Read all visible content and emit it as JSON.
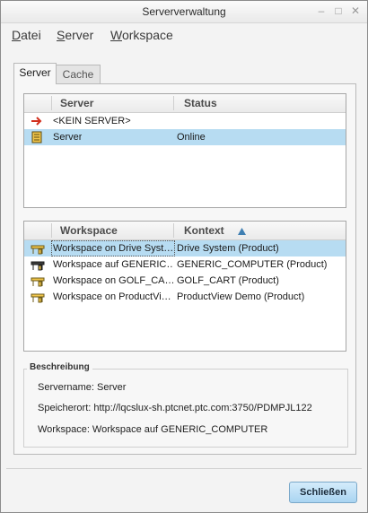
{
  "window": {
    "title": "Serververwaltung",
    "controls": [
      "minimize-icon",
      "maximize-icon",
      "close-icon"
    ]
  },
  "menu": [
    {
      "mnemonic": "D",
      "rest": "atei"
    },
    {
      "mnemonic": "S",
      "rest": "erver"
    },
    {
      "mnemonic": "W",
      "rest": "orkspace"
    }
  ],
  "tabs": {
    "server": "Server",
    "cache": "Cache"
  },
  "server_table": {
    "columns": {
      "server": "Server",
      "status": "Status"
    },
    "rows": [
      {
        "icon": "red-arrow-icon",
        "server": "<KEIN SERVER>",
        "status": ""
      },
      {
        "icon": "server-icon",
        "server": "Server",
        "status": "Online"
      }
    ]
  },
  "workspace_table": {
    "columns": {
      "workspace": "Workspace",
      "context": "Kontext"
    },
    "sort": "ascending",
    "rows": [
      {
        "icon": "workspace-icon",
        "workspace": "Workspace on Drive Syst…",
        "context": "Drive System (Product)"
      },
      {
        "icon": "workspace-dark-icon",
        "workspace": "Workspace auf GENERIC…",
        "context": "GENERIC_COMPUTER (Product)"
      },
      {
        "icon": "workspace-icon",
        "workspace": "Workspace on GOLF_CA…",
        "context": "GOLF_CART (Product)"
      },
      {
        "icon": "workspace-icon",
        "workspace": "Workspace on ProductVi…",
        "context": "ProductView Demo (Product)"
      }
    ]
  },
  "description": {
    "legend": "Beschreibung",
    "servername": "Servername: Server",
    "speicherort": "Speicherort: http://lqcslux-sh.ptcnet.ptc.com:3750/PDMPJL122",
    "workspace": "Workspace: Workspace auf GENERIC_COMPUTER"
  },
  "buttons": {
    "close": "Schließen"
  },
  "colors": {
    "selection": "#b7dcf2",
    "button": "#bfe1f7",
    "arrow": "#d2301e"
  }
}
